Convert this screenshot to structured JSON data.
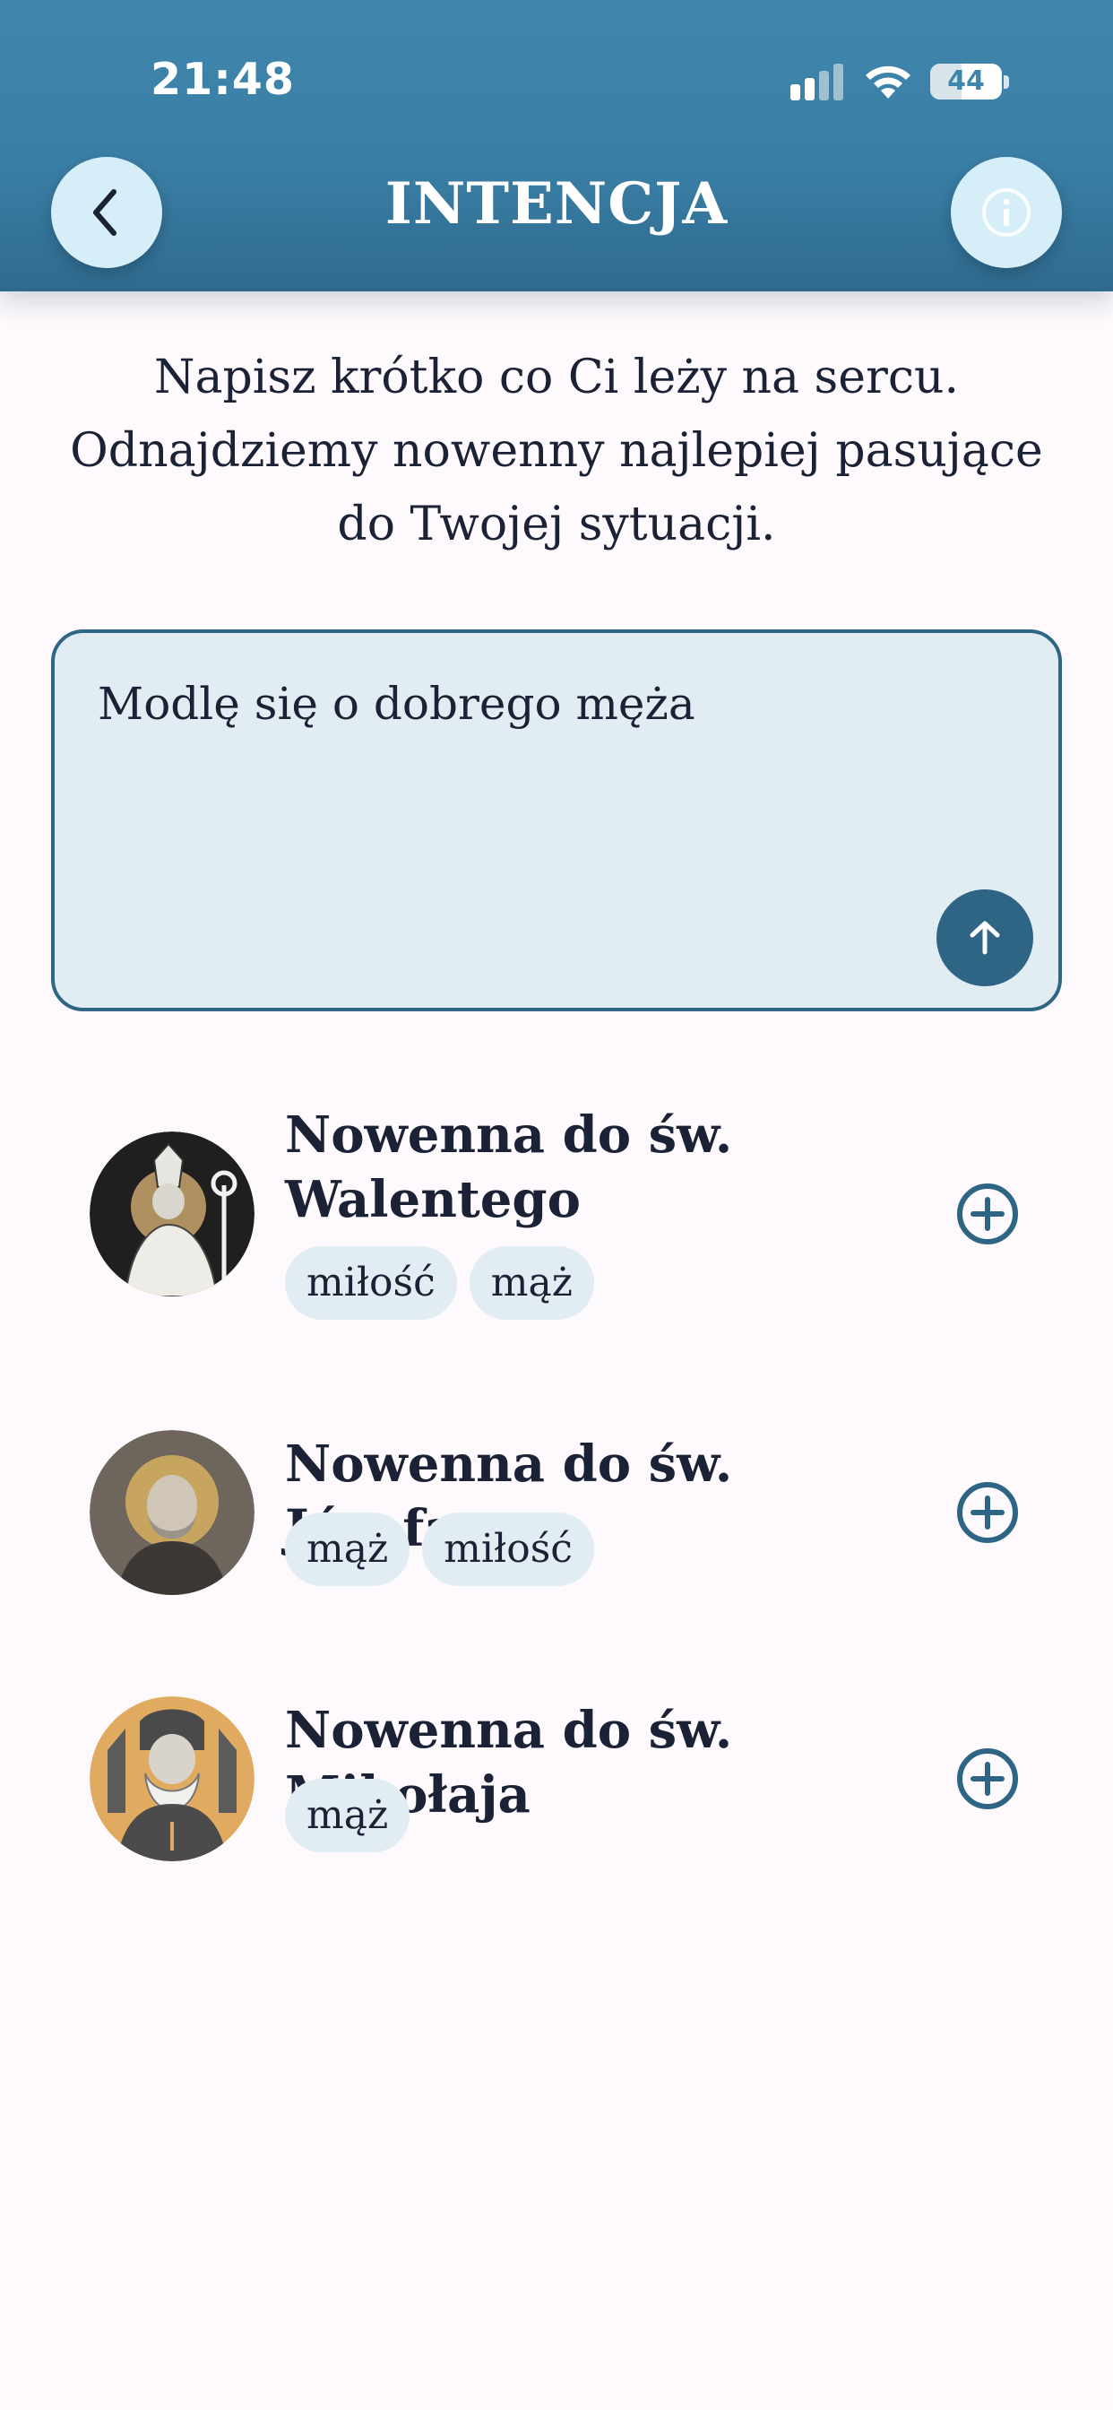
{
  "status_bar": {
    "time": "21:48",
    "battery": "44",
    "battery_level": 0.44
  },
  "header": {
    "title": "INTENCJA"
  },
  "intro": {
    "text": "Napisz krótko co Ci leży na sercu. Odnajdziemy nowenny najlepiej pasujące do Twojej sytuacji."
  },
  "input": {
    "value": "Modlę się o dobrego męża"
  },
  "colors": {
    "accent": "#2e6484",
    "header": "#3f86ac",
    "tag_bg": "#e1edf3",
    "background": "#fdf9fc"
  },
  "results": [
    {
      "title": "Nowenna do św. Walentego",
      "tags": [
        "miłość",
        "mąż"
      ],
      "avatar": "st-valentine-portrait"
    },
    {
      "title": "Nowenna do św. Józefa",
      "tags": [
        "mąż",
        "miłość"
      ],
      "avatar": "st-joseph-portrait"
    },
    {
      "title": "Nowenna do św. Mikołaja",
      "tags": [
        "mąż"
      ],
      "avatar": "st-nicholas-portrait"
    }
  ]
}
